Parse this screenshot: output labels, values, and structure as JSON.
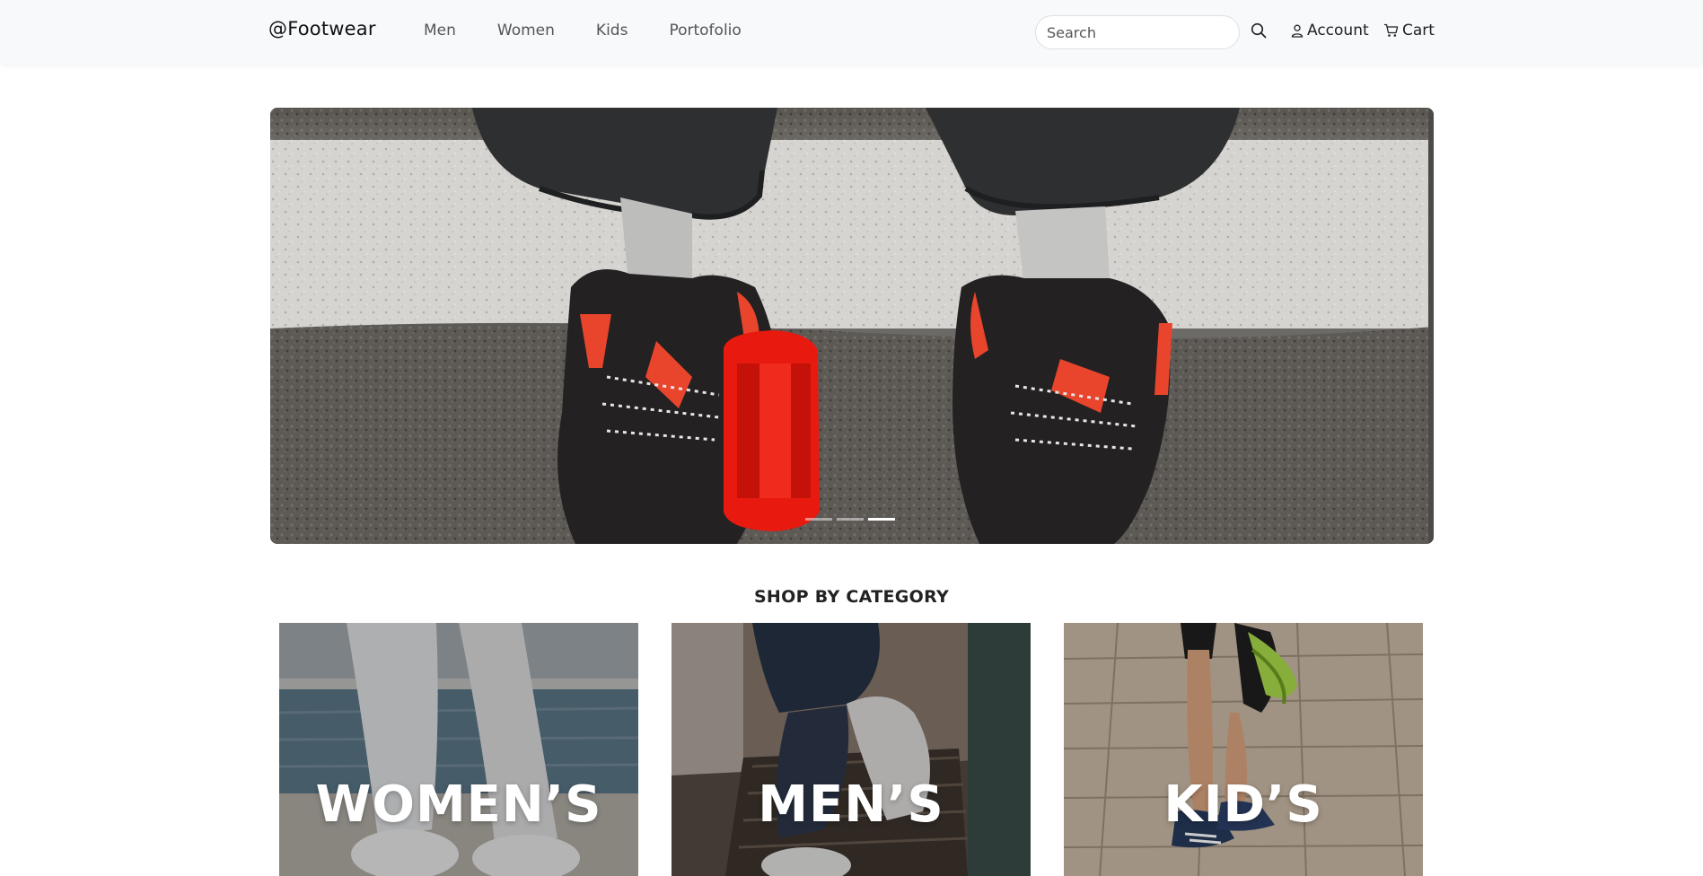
{
  "nav": {
    "brand": "@Footwear",
    "links": [
      "Men",
      "Women",
      "Kids",
      "Portofolio"
    ],
    "search_placeholder": "Search",
    "search_icon": "search-icon",
    "account_label": "Account",
    "account_icon": "person-icon",
    "cart_label": "Cart",
    "cart_icon": "cart-icon"
  },
  "carousel": {
    "slide_count": 3,
    "active_index": 2
  },
  "category": {
    "title": "SHOP BY CATEGORY",
    "cards": [
      {
        "label": "WOMEN’S"
      },
      {
        "label": "MEN’S"
      },
      {
        "label": "KID’S"
      }
    ]
  },
  "colors": {
    "navbar_bg": "#f8f9fb",
    "shoe_accent": "#e8452c",
    "reflector_red": "#e81a10"
  }
}
